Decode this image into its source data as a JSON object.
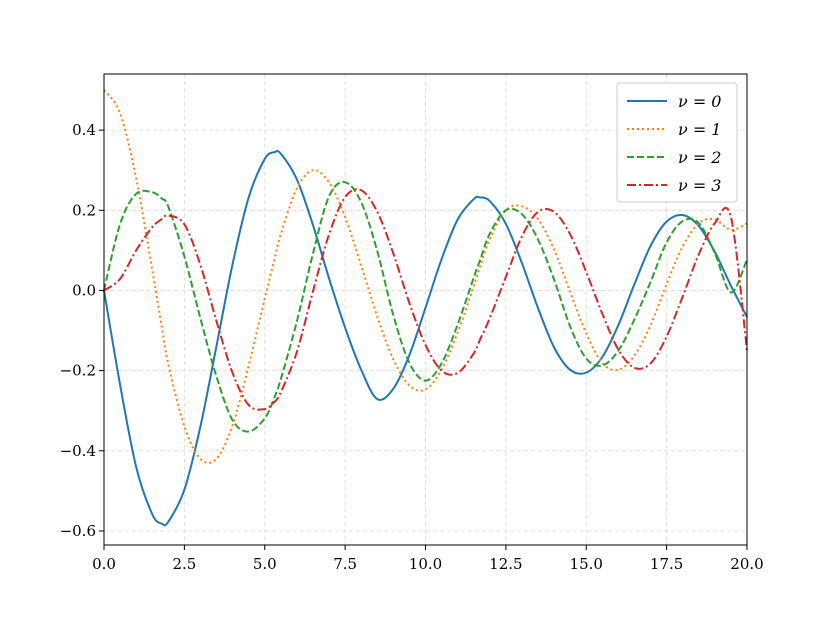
{
  "chart_data": {
    "type": "line",
    "title": "",
    "xlabel": "",
    "ylabel": "",
    "xlim": [
      0,
      20
    ],
    "ylim": [
      -0.635,
      0.54
    ],
    "xticks": [
      0,
      2.5,
      5,
      7.5,
      10,
      12.5,
      15,
      17.5,
      20
    ],
    "xtick_labels": [
      "0.0",
      "2.5",
      "5.0",
      "7.5",
      "10.0",
      "12.5",
      "15.0",
      "17.5",
      "20.0"
    ],
    "yticks": [
      -0.6,
      -0.4,
      -0.2,
      0.0,
      0.2,
      0.4
    ],
    "ytick_labels": [
      "−0.6",
      "−0.4",
      "−0.2",
      "0.0",
      "0.2",
      "0.4"
    ],
    "grid": true,
    "legend_position": "top-right",
    "x": [
      0,
      0.5,
      1,
      1.5,
      1.8,
      2,
      2.5,
      3,
      3.5,
      4,
      4.5,
      5,
      5.3,
      5.5,
      6,
      6.5,
      7,
      7.5,
      8,
      8.5,
      9,
      9.5,
      10,
      10.5,
      11,
      11.5,
      11.7,
      12,
      12.5,
      13,
      13.5,
      14,
      14.5,
      15,
      15.5,
      16,
      16.5,
      17,
      17.5,
      18,
      18.5,
      19,
      19.5,
      20
    ],
    "series": [
      {
        "name": "ν = 0",
        "color": "#1f77b4",
        "dash": "solid",
        "values": [
          0,
          -0.235,
          -0.44,
          -0.558,
          -0.582,
          -0.577,
          -0.497,
          -0.339,
          -0.138,
          0.066,
          0.232,
          0.328,
          0.345,
          0.341,
          0.277,
          0.163,
          0.03,
          -0.093,
          -0.198,
          -0.271,
          -0.245,
          -0.161,
          -0.043,
          0.078,
          0.177,
          0.228,
          0.232,
          0.223,
          0.166,
          0.068,
          -0.044,
          -0.142,
          -0.198,
          -0.205,
          -0.166,
          -0.086,
          0.016,
          0.111,
          0.172,
          0.188,
          0.161,
          0.096,
          0.012,
          -0.066
        ]
      },
      {
        "name": "ν = 1",
        "color": "#ff7f0e",
        "dash": "dotted",
        "values": [
          0.5,
          0.442,
          0.28,
          0.052,
          -0.092,
          -0.184,
          -0.339,
          -0.42,
          -0.42,
          -0.336,
          -0.188,
          -0.02,
          0.077,
          0.14,
          0.255,
          0.3,
          0.27,
          0.183,
          0.062,
          -0.065,
          -0.172,
          -0.237,
          -0.247,
          -0.197,
          -0.105,
          0.011,
          0.06,
          0.128,
          0.2,
          0.21,
          0.178,
          0.102,
          -0.004,
          -0.107,
          -0.181,
          -0.198,
          -0.162,
          -0.087,
          0.016,
          0.11,
          0.168,
          0.177,
          0.151,
          0.167
        ]
      },
      {
        "name": "ν = 2",
        "color": "#2ca02c",
        "dash": "dashed",
        "values": [
          0,
          0.166,
          0.241,
          0.245,
          0.229,
          0.209,
          0.085,
          -0.07,
          -0.215,
          -0.324,
          -0.352,
          -0.319,
          -0.267,
          -0.221,
          -0.077,
          0.092,
          0.235,
          0.27,
          0.22,
          0.098,
          -0.062,
          -0.181,
          -0.225,
          -0.182,
          -0.085,
          0.032,
          0.076,
          0.142,
          0.2,
          0.19,
          0.127,
          0.027,
          -0.09,
          -0.17,
          -0.187,
          -0.15,
          -0.072,
          0.021,
          0.12,
          0.173,
          0.168,
          0.093,
          -0.005,
          0.077
        ]
      },
      {
        "name": "ν = 3",
        "color": "#d62728",
        "dash": "dashdot",
        "values": [
          0,
          0.029,
          0.1,
          0.158,
          0.178,
          0.187,
          0.165,
          0.063,
          -0.077,
          -0.206,
          -0.286,
          -0.296,
          -0.278,
          -0.254,
          -0.153,
          -0.002,
          0.14,
          0.233,
          0.25,
          0.196,
          0.092,
          -0.032,
          -0.136,
          -0.2,
          -0.206,
          -0.157,
          -0.122,
          -0.069,
          0.034,
          0.135,
          0.196,
          0.196,
          0.14,
          0.046,
          -0.058,
          -0.148,
          -0.193,
          -0.182,
          -0.115,
          -0.015,
          0.09,
          0.168,
          0.183,
          -0.15
        ]
      }
    ]
  },
  "legend": [
    {
      "label": "ν = 0",
      "color": "#1f77b4",
      "dash": "solid"
    },
    {
      "label": "ν = 1",
      "color": "#ff7f0e",
      "dash": "dotted"
    },
    {
      "label": "ν = 2",
      "color": "#2ca02c",
      "dash": "dashed"
    },
    {
      "label": "ν = 3",
      "color": "#d62728",
      "dash": "dashdot"
    }
  ]
}
